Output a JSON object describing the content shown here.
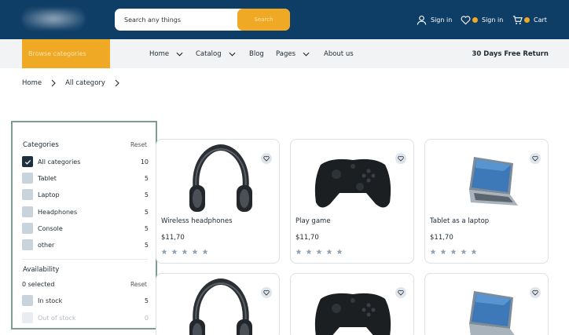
{
  "colors": {
    "primary": "#0e3d66",
    "accent": "#f0a925",
    "filter_border": "#7d9c93",
    "star": "#8fa3b5"
  },
  "header": {
    "logo_icon": "blurred-logo",
    "search": {
      "placeholder": "Search any things",
      "button_label": "Search"
    },
    "actions": [
      {
        "icon": "user-icon",
        "label": "Sign in"
      },
      {
        "icon": "heart-icon",
        "label": "Sign in"
      },
      {
        "icon": "cart-icon",
        "label": "Cart"
      }
    ]
  },
  "nav": {
    "browse_label": "Browse categories",
    "items": [
      {
        "label": "Home",
        "has_dropdown": true
      },
      {
        "label": "Catalog",
        "has_dropdown": true
      },
      {
        "label": "Blog",
        "has_dropdown": false
      },
      {
        "label": "Pages",
        "has_dropdown": true
      },
      {
        "label": "About us",
        "has_dropdown": false
      }
    ],
    "promo": "30 Days Free Return"
  },
  "breadcrumb": [
    "Home",
    "All category"
  ],
  "filters": {
    "categories": {
      "title": "Categories",
      "reset": "Reset",
      "items": [
        {
          "label": "All categories",
          "count": "10",
          "checked": true
        },
        {
          "label": "Tablet",
          "count": "5",
          "checked": false
        },
        {
          "label": "Laptop",
          "count": "5",
          "checked": false
        },
        {
          "label": "Headphones",
          "count": "5",
          "checked": false
        },
        {
          "label": "Console",
          "count": "5",
          "checked": false
        },
        {
          "label": "other",
          "count": "5",
          "checked": false
        }
      ]
    },
    "availability": {
      "title": "Availability",
      "selected": "0 selected",
      "reset": "Reset",
      "items": [
        {
          "label": "In stock",
          "count": "5",
          "disabled": false
        },
        {
          "label": "Out of stock",
          "count": "0",
          "disabled": true
        }
      ]
    }
  },
  "products": [
    {
      "name": "Wireless headphones",
      "price": "$11,70",
      "image": "headphones-image",
      "stars": 5
    },
    {
      "name": "Play game",
      "price": "$11,70",
      "image": "gamepad-image",
      "stars": 5
    },
    {
      "name": "Tablet as a laptop",
      "price": "$11,70",
      "image": "laptop-image",
      "stars": 5
    },
    {
      "name": "",
      "price": "",
      "image": "headphones-image",
      "stars": 0
    },
    {
      "name": "",
      "price": "",
      "image": "gamepad-image",
      "stars": 0
    },
    {
      "name": "",
      "price": "",
      "image": "laptop-image",
      "stars": 0
    }
  ]
}
